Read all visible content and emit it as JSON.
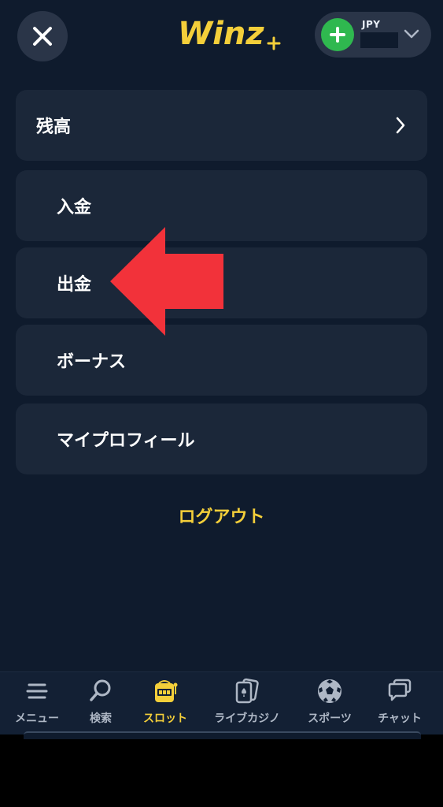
{
  "header": {
    "logo_text": "Winz",
    "wallet": {
      "currency": "JPY"
    }
  },
  "menu": {
    "balance": "残高",
    "deposit": "入金",
    "withdraw": "出金",
    "bonus": "ボーナス",
    "profile": "マイプロフィール",
    "logout": "ログアウト"
  },
  "bottom_nav": [
    {
      "label": "メニュー",
      "icon": "menu-icon"
    },
    {
      "label": "検索",
      "icon": "search-icon"
    },
    {
      "label": "スロット",
      "icon": "slot-machine-icon",
      "active": true
    },
    {
      "label": "ライブカジノ",
      "icon": "cards-icon"
    },
    {
      "label": "スポーツ",
      "icon": "soccer-ball-icon"
    },
    {
      "label": "チャット",
      "icon": "chat-icon"
    }
  ],
  "colors": {
    "background": "#0f1b2d",
    "card": "#1b2739",
    "accent_yellow": "#f4cf3a",
    "green": "#2fb84f",
    "annotation_red": "#f2323a"
  }
}
